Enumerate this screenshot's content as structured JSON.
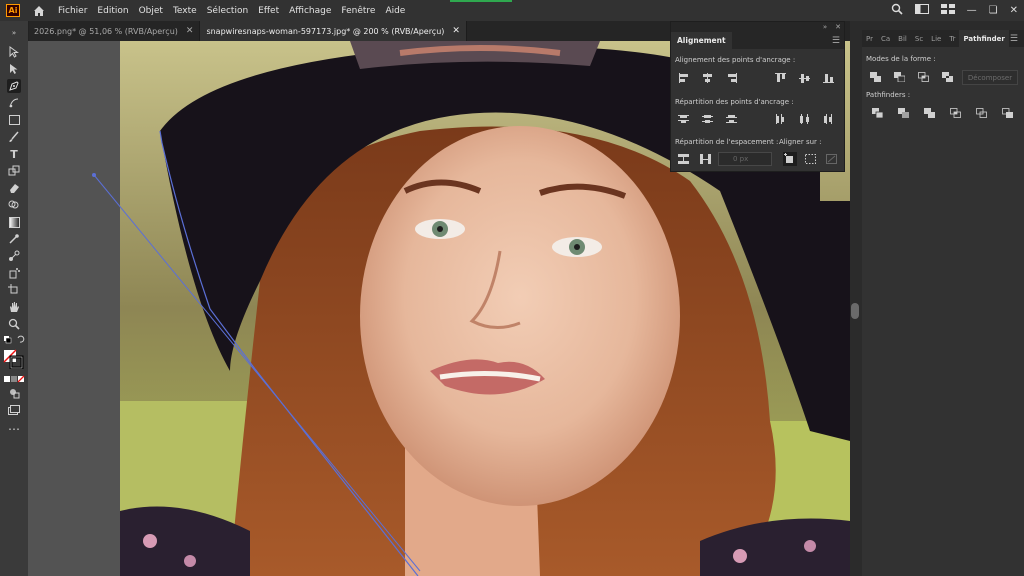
{
  "app": {
    "logo": "Ai"
  },
  "menu": [
    "Fichier",
    "Edition",
    "Objet",
    "Texte",
    "Sélection",
    "Effet",
    "Affichage",
    "Fenêtre",
    "Aide"
  ],
  "tabs": [
    {
      "label": "2026.png* @ 51,06 % (RVB/Aperçu)",
      "active": false
    },
    {
      "label": "snapwiresnaps-woman-597173.jpg* @ 200 % (RVB/Aperçu)",
      "active": true
    }
  ],
  "align_panel": {
    "title": "Alignement",
    "align_objects_label": "Alignement des points d'ancrage :",
    "distribute_label": "Répartition des points d'ancrage :",
    "distribute_spacing_label": "Répartition de l'espacement :",
    "align_to_label": "Aligner sur :",
    "spacing_value": "0 px"
  },
  "pathfinder_panel": {
    "tabs": [
      "Pr",
      "Ca",
      "Bil",
      "Sc",
      "Lie",
      "Tr",
      "Pathfinder"
    ],
    "shape_modes_label": "Modes de la forme :",
    "expand_button": "Décomposer",
    "pathfinders_label": "Pathfinders :"
  },
  "colors": {
    "accent": "#2fa84f",
    "logo": "#ff9a00",
    "path_line": "#5b6fd6"
  }
}
